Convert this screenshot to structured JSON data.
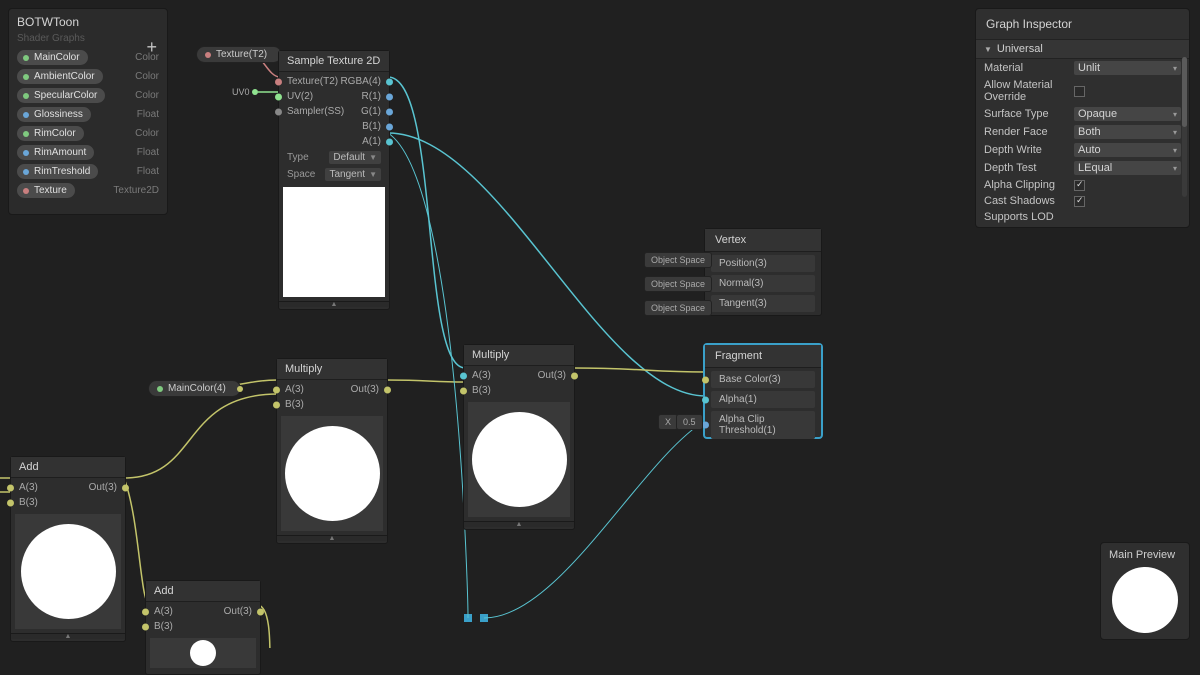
{
  "blackboard": {
    "title": "BOTWToon",
    "subtitle": "Shader Graphs",
    "add": "+",
    "items": [
      {
        "name": "MainColor",
        "type": "Color",
        "color": "#7fc97f"
      },
      {
        "name": "AmbientColor",
        "type": "Color",
        "color": "#7fc97f"
      },
      {
        "name": "SpecularColor",
        "type": "Color",
        "color": "#7fc97f"
      },
      {
        "name": "Glossiness",
        "type": "Float",
        "color": "#6aa6d8"
      },
      {
        "name": "RimColor",
        "type": "Color",
        "color": "#7fc97f"
      },
      {
        "name": "RimAmount",
        "type": "Float",
        "color": "#6aa6d8"
      },
      {
        "name": "RimTreshold",
        "type": "Float",
        "color": "#6aa6d8"
      },
      {
        "name": "Texture",
        "type": "Texture2D",
        "color": "#c97f7f"
      }
    ]
  },
  "nodes": {
    "texture_mini": {
      "label": "Texture(T2)",
      "color": "#c97f7f"
    },
    "maincolor_mini": {
      "label": "MainColor(4)",
      "color": "#7fc97f"
    },
    "uv_label": "UV0",
    "sample": {
      "title": "Sample Texture 2D",
      "in": [
        {
          "label": "Texture(T2)",
          "color": "#c97f7f"
        },
        {
          "label": "UV(2)",
          "color": "#8fe38f"
        },
        {
          "label": "Sampler(SS)",
          "color": "#888"
        }
      ],
      "out": [
        {
          "label": "RGBA(4)",
          "color": "#59c4d1"
        },
        {
          "label": "R(1)",
          "color": "#6aa6d8"
        },
        {
          "label": "G(1)",
          "color": "#6aa6d8"
        },
        {
          "label": "B(1)",
          "color": "#6aa6d8"
        },
        {
          "label": "A(1)",
          "color": "#6aa6d8"
        }
      ],
      "type_label": "Type",
      "type_val": "Default",
      "space_label": "Space",
      "space_val": "Tangent"
    },
    "multiply1": {
      "title": "Multiply",
      "inA": "A(3)",
      "inB": "B(3)",
      "out": "Out(3)"
    },
    "multiply2": {
      "title": "Multiply",
      "inA": "A(3)",
      "inB": "B(3)",
      "out": "Out(3)"
    },
    "add1": {
      "title": "Add",
      "inA": "A(3)",
      "inB": "B(3)",
      "out": "Out(3)"
    },
    "add2": {
      "title": "Add",
      "inA": "A(3)",
      "inB": "B(3)",
      "out": "Out(3)"
    }
  },
  "vertex": {
    "title": "Vertex",
    "badge": "Object Space",
    "rows": [
      {
        "label": "Position(3)",
        "color": "#d1c46a"
      },
      {
        "label": "Normal(3)",
        "color": "#d1c46a"
      },
      {
        "label": "Tangent(3)",
        "color": "#d1c46a"
      }
    ]
  },
  "fragment": {
    "title": "Fragment",
    "rows": [
      {
        "label": "Base Color(3)",
        "color": "#d1c46a",
        "lock": false
      },
      {
        "label": "Alpha(1)",
        "color": "#6aa6d8",
        "lock": false
      },
      {
        "label": "Alpha Clip Threshold(1)",
        "color": "#6aa6d8",
        "lock": true,
        "pre": "X",
        "val": "0.5"
      }
    ]
  },
  "inspector": {
    "title": "Graph Inspector",
    "section": "Universal",
    "rows": [
      {
        "label": "Material",
        "ctrl": "select",
        "value": "Unlit"
      },
      {
        "label": "Allow Material Override",
        "ctrl": "check",
        "value": false
      },
      {
        "label": "Surface Type",
        "ctrl": "select",
        "value": "Opaque"
      },
      {
        "label": "Render Face",
        "ctrl": "select",
        "value": "Both"
      },
      {
        "label": "Depth Write",
        "ctrl": "select",
        "value": "Auto"
      },
      {
        "label": "Depth Test",
        "ctrl": "select",
        "value": "LEqual"
      },
      {
        "label": "Alpha Clipping",
        "ctrl": "check",
        "value": true
      },
      {
        "label": "Cast Shadows",
        "ctrl": "check",
        "value": true
      },
      {
        "label": "Supports LOD",
        "ctrl": "check",
        "value": false
      }
    ]
  },
  "main_preview": {
    "title": "Main Preview"
  }
}
